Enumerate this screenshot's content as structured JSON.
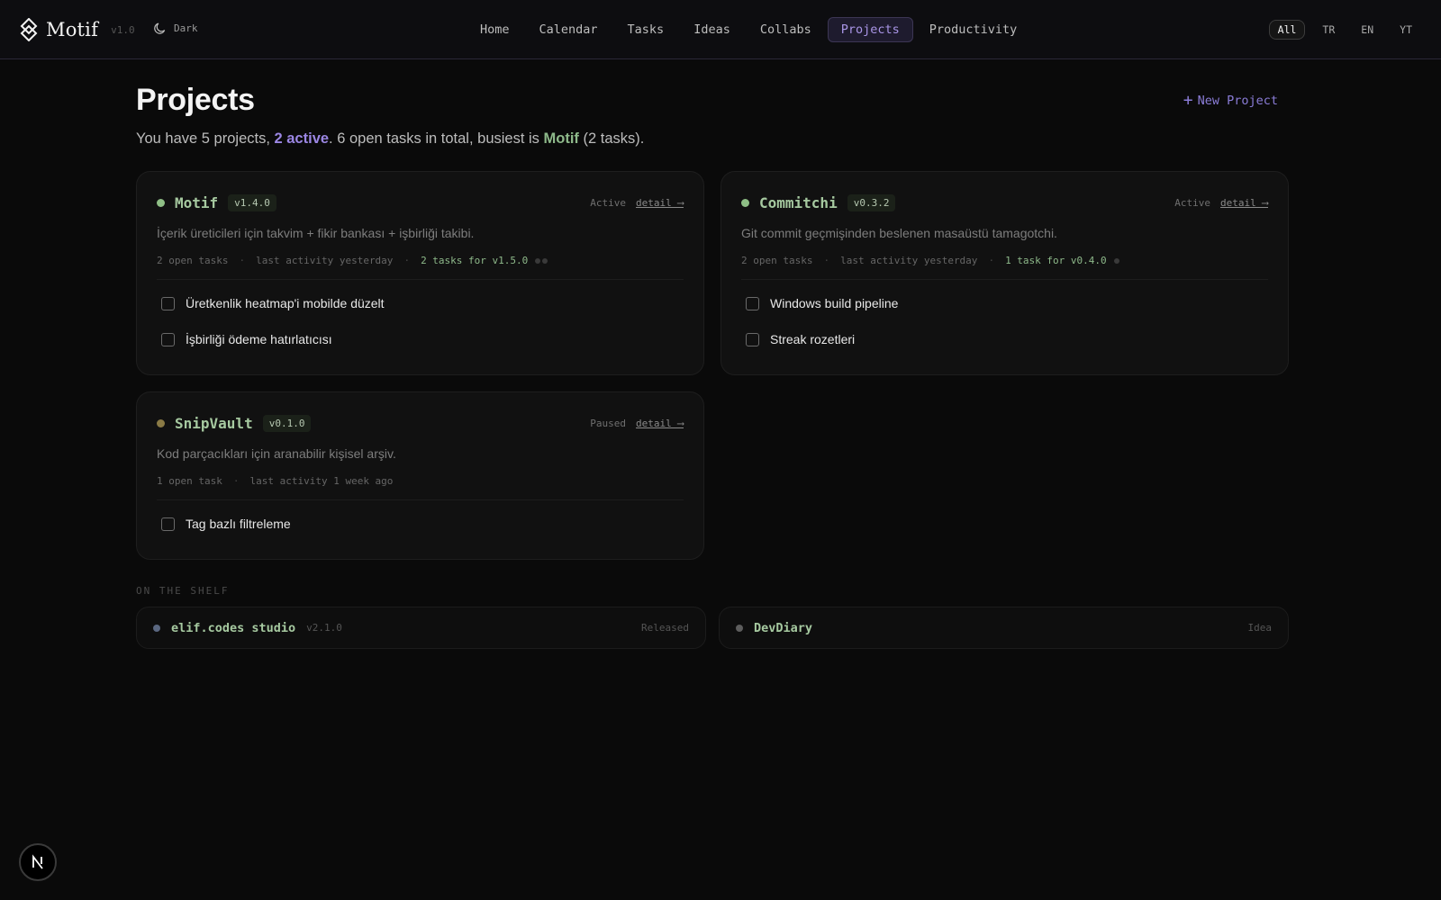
{
  "app": {
    "name": "Motif",
    "version": "v1.0",
    "theme_label": "Dark"
  },
  "nav": {
    "items": [
      "Home",
      "Calendar",
      "Tasks",
      "Ideas",
      "Collabs",
      "Projects",
      "Productivity"
    ],
    "active": "Projects"
  },
  "lang": {
    "items": [
      "All",
      "TR",
      "EN",
      "YT"
    ],
    "active": "All"
  },
  "header": {
    "title": "Projects",
    "new_project_label": "New Project",
    "summary": {
      "prefix": "You have 5 projects, ",
      "active_count": "2 active",
      "middle": ". 6 open tasks in total, busiest is ",
      "busiest": "Motif",
      "suffix": " (2 tasks)."
    }
  },
  "projects": [
    {
      "name": "Motif",
      "version": "v1.4.0",
      "status": "Active",
      "detail_label": "detail ⟶",
      "description": "İçerik üreticileri için takvim + fikir bankası + işbirliği takibi.",
      "open_tasks": "2 open tasks",
      "last_activity": "last activity yesterday",
      "release_info": "2 tasks for v1.5.0",
      "tasks": [
        "Üretkenlik heatmap'i mobilde düzelt",
        "İşbirliği ödeme hatırlatıcısı"
      ]
    },
    {
      "name": "Commitchi",
      "version": "v0.3.2",
      "status": "Active",
      "detail_label": "detail ⟶",
      "description": "Git commit geçmişinden beslenen masaüstü tamagotchi.",
      "open_tasks": "2 open tasks",
      "last_activity": "last activity yesterday",
      "release_info": "1 task for v0.4.0",
      "tasks": [
        "Windows build pipeline",
        "Streak rozetleri"
      ]
    },
    {
      "name": "SnipVault",
      "version": "v0.1.0",
      "status": "Paused",
      "detail_label": "detail ⟶",
      "description": "Kod parçacıkları için aranabilir kişisel arşiv.",
      "open_tasks": "1 open task",
      "last_activity": "last activity 1 week ago",
      "tasks": [
        "Tag bazlı filtreleme"
      ]
    }
  ],
  "shelf": {
    "label": "ON THE SHELF",
    "items": [
      {
        "name": "elif.codes studio",
        "version": "v2.1.0",
        "status": "Released"
      },
      {
        "name": "DevDiary",
        "status": "Idea"
      }
    ]
  },
  "colors": {
    "accent_purple": "#9b86e3",
    "project_green": "#a6c9a0",
    "active_dot": "#8fbf86",
    "paused_dot": "#8a7a45",
    "released_dot": "#5a6780",
    "idea_dot": "#5d5d5d"
  },
  "icons": {
    "brand": "motif-logo-icon",
    "theme": "moon-icon",
    "new": "plus-icon",
    "badge": "nextjs-icon"
  }
}
